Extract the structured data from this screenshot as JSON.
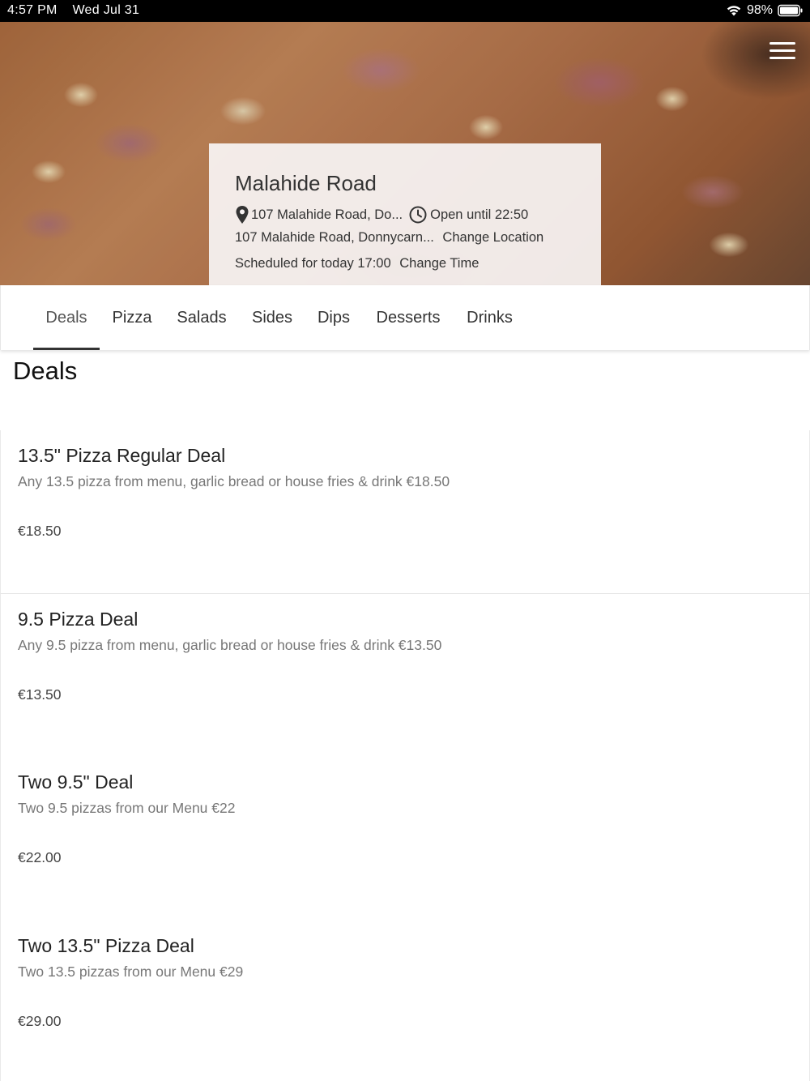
{
  "status_bar": {
    "time": "4:57 PM",
    "date": "Wed Jul 31",
    "battery": "98%"
  },
  "store": {
    "name": "Malahide Road",
    "address_short": "107 Malahide Road, Do...",
    "hours": "Open until 22:50",
    "address_long": "107 Malahide Road, Donnycarn...",
    "change_location": "Change Location",
    "schedule": "Scheduled for today 17:00",
    "change_time": "Change Time"
  },
  "tabs": [
    "Deals",
    "Pizza",
    "Salads",
    "Sides",
    "Dips",
    "Desserts",
    "Drinks"
  ],
  "active_tab": "Deals",
  "section_title": "Deals",
  "deals": [
    {
      "name": "13.5\" Pizza Regular Deal",
      "description": "Any 13.5 pizza from menu, garlic bread or house fries & drink €18.50",
      "price": "€18.50"
    },
    {
      "name": "9.5 Pizza Deal",
      "description": "Any 9.5 pizza from menu, garlic bread or house fries & drink €13.50",
      "price": "€13.50"
    },
    {
      "name": "Two 9.5\" Deal",
      "description": "Two 9.5 pizzas from our Menu €22",
      "price": "€22.00"
    },
    {
      "name": "Two 13.5\" Pizza Deal",
      "description": "Two 13.5 pizzas from our Menu €29",
      "price": "€29.00"
    }
  ],
  "icons": {
    "menu": "hamburger-menu-icon",
    "location": "map-pin-icon",
    "clock": "clock-icon",
    "wifi": "wifi-icon",
    "battery": "battery-icon"
  }
}
